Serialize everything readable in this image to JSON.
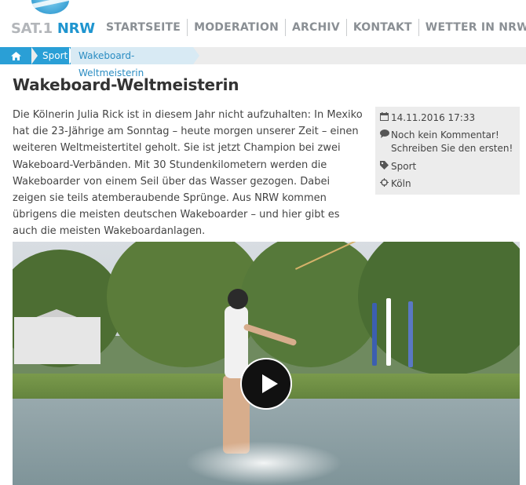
{
  "logo": {
    "sat": "SAT.1",
    "nrw": "NRW"
  },
  "nav": {
    "items": [
      {
        "label": "STARTSEITE"
      },
      {
        "label": "MODERATION"
      },
      {
        "label": "ARCHIV"
      },
      {
        "label": "KONTAKT"
      },
      {
        "label": "WETTER IN NRW"
      }
    ]
  },
  "breadcrumb": {
    "home_icon": "home-icon",
    "items": [
      {
        "label": "Sport"
      },
      {
        "label": "Wakeboard-Weltmeisterin"
      }
    ]
  },
  "article": {
    "title": "Wakeboard-Weltmeisterin",
    "body": "Die Kölnerin Julia Rick ist in diesem Jahr nicht aufzuhalten: In Mexiko hat die 23-Jährige am Sonntag – heute morgen unserer Zeit – einen weiteren Weltmeistertitel geholt. Sie ist jetzt Champion bei zwei Wakeboard-Verbänden. Mit 30 Stundenkilometern werden die Wakeboarder von einem Seil über das Wasser gezogen. Dabei zeigen sie teils atemberaubende Sprünge. Aus NRW kommen übrigens die meisten deutschen Wakeboarder – und hier gibt es auch die meisten Wakeboardanlagen."
  },
  "meta": {
    "date": "14.11.2016 17:33",
    "comments": "Noch kein Kommentar! Schreiben Sie den ersten!",
    "category": "Sport",
    "location": "Köln",
    "icons": {
      "date": "calendar-icon",
      "comments": "comment-icon",
      "category": "tag-icon",
      "location": "crosshairs-icon"
    }
  },
  "video": {
    "play_icon": "play-icon"
  },
  "colors": {
    "brand_blue": "#2a9fd6",
    "nav_gray": "#8a8f94",
    "breadcrumb_bg": "#ececec",
    "breadcrumb_current_bg": "#d8eaf4"
  }
}
